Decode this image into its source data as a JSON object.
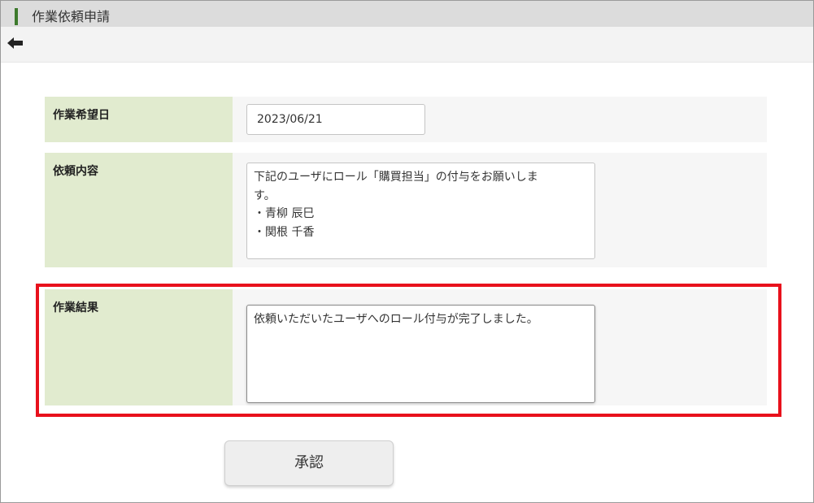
{
  "window": {
    "title": "作業依頼申請"
  },
  "toolbar": {
    "back_icon": "arrow-left-icon"
  },
  "form": {
    "desired_date": {
      "label": "作業希望日",
      "value": "2023/06/21"
    },
    "request_content": {
      "label": "依頼内容",
      "value": "下記のユーザにロール「購買担当」の付与をお願いしま\nす。\n・青柳 辰巳\n・関根 千香"
    },
    "work_result": {
      "label": "作業結果",
      "value": "依頼いただいたユーザへのロール付与が完了しました。"
    }
  },
  "actions": {
    "approve_label": "承認"
  },
  "colors": {
    "label_bg": "#e1ebcf",
    "highlight": "#e8111c",
    "accent": "#3d7a2c"
  }
}
